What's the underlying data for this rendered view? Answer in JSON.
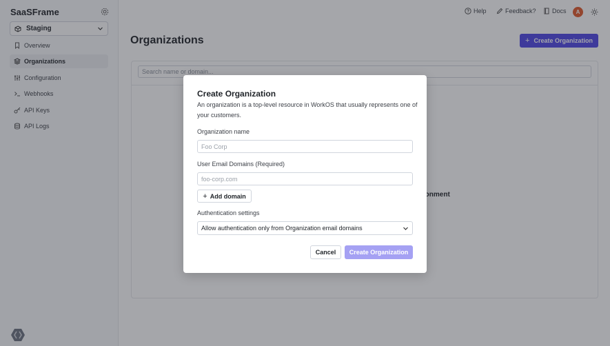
{
  "sidebar": {
    "brand": "SaaSFrame",
    "environment": "Staging",
    "items": [
      {
        "label": "Overview",
        "icon": "bookmark-icon"
      },
      {
        "label": "Organizations",
        "icon": "layers-icon",
        "active": true
      },
      {
        "label": "Configuration",
        "icon": "sliders-icon"
      },
      {
        "label": "Webhooks",
        "icon": "terminal-icon"
      },
      {
        "label": "API Keys",
        "icon": "key-icon"
      },
      {
        "label": "API Logs",
        "icon": "database-icon"
      }
    ]
  },
  "topbar": {
    "help": "Help",
    "feedback": "Feedback?",
    "docs": "Docs",
    "avatar_initial": "A"
  },
  "main": {
    "title": "Organizations",
    "create_button": "Create Organization",
    "search_placeholder": "Search name or domain...",
    "empty_state_fragment": "ironment"
  },
  "modal": {
    "title": "Create Organization",
    "description": "An organization is a top-level resource in WorkOS that usually represents one of your customers.",
    "org_name_label": "Organization name",
    "org_name_placeholder": "Foo Corp",
    "domains_label": "User Email Domains (Required)",
    "domain_placeholder": "foo-corp.com",
    "add_domain": "Add domain",
    "auth_label": "Authentication settings",
    "auth_value": "Allow authentication only from Organization email domains",
    "cancel": "Cancel",
    "submit": "Create Organization"
  },
  "colors": {
    "primary": "#4f46e5",
    "primary_disabled": "#a5a1f3",
    "avatar": "#e0592a"
  }
}
